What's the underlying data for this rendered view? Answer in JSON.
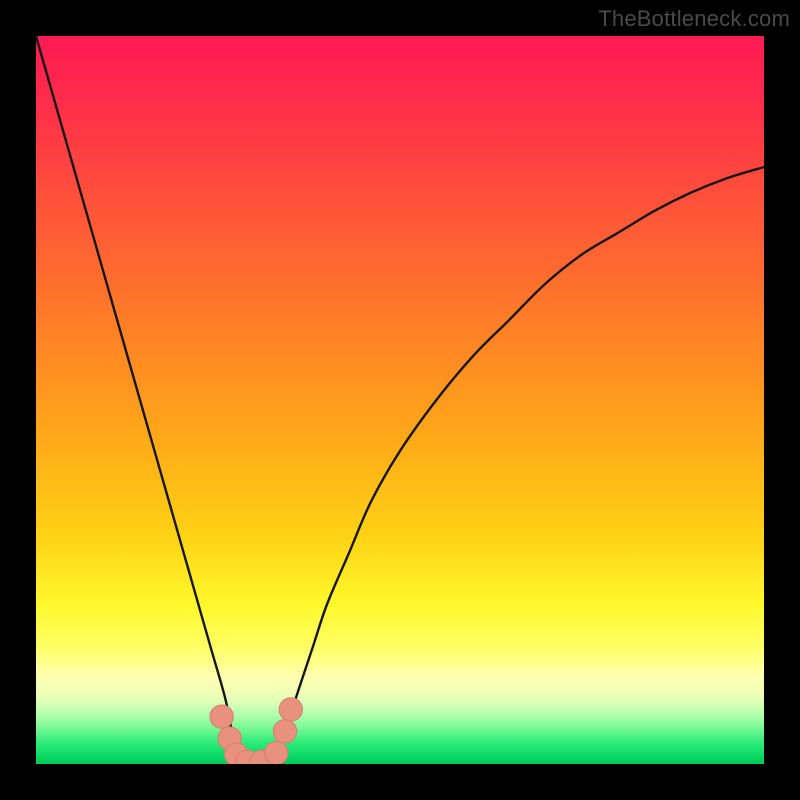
{
  "watermark": {
    "text": "TheBottleneck.com"
  },
  "colors": {
    "curve_stroke": "#161616",
    "marker_fill": "#e9917f",
    "marker_stroke": "#d8806e"
  },
  "chart_data": {
    "type": "line",
    "title": "",
    "xlabel": "",
    "ylabel": "",
    "xlim": [
      0,
      100
    ],
    "ylim": [
      0,
      100
    ],
    "grid": false,
    "legend": false,
    "series": [
      {
        "name": "bottleneck-curve",
        "x": [
          0,
          2,
          4,
          6,
          8,
          10,
          12,
          14,
          16,
          18,
          20,
          22,
          24,
          26,
          27,
          28,
          30,
          32,
          34,
          36,
          38,
          40,
          43,
          46,
          50,
          55,
          60,
          65,
          70,
          75,
          80,
          85,
          90,
          95,
          100
        ],
        "y": [
          100,
          93,
          86,
          79,
          72,
          65,
          58,
          51,
          44,
          37,
          30,
          23,
          16,
          9,
          4,
          0,
          0,
          0,
          4,
          10,
          16,
          22,
          29,
          36,
          43,
          50,
          56,
          61,
          66,
          70,
          73,
          76,
          78.5,
          80.5,
          82
        ]
      }
    ],
    "markers": [
      {
        "x": 25.5,
        "y": 6.5
      },
      {
        "x": 26.6,
        "y": 3.5
      },
      {
        "x": 27.5,
        "y": 1.3
      },
      {
        "x": 29.0,
        "y": 0.3
      },
      {
        "x": 31.0,
        "y": 0.3
      },
      {
        "x": 33.0,
        "y": 1.5
      },
      {
        "x": 34.2,
        "y": 4.5
      },
      {
        "x": 35.0,
        "y": 7.5
      }
    ]
  }
}
